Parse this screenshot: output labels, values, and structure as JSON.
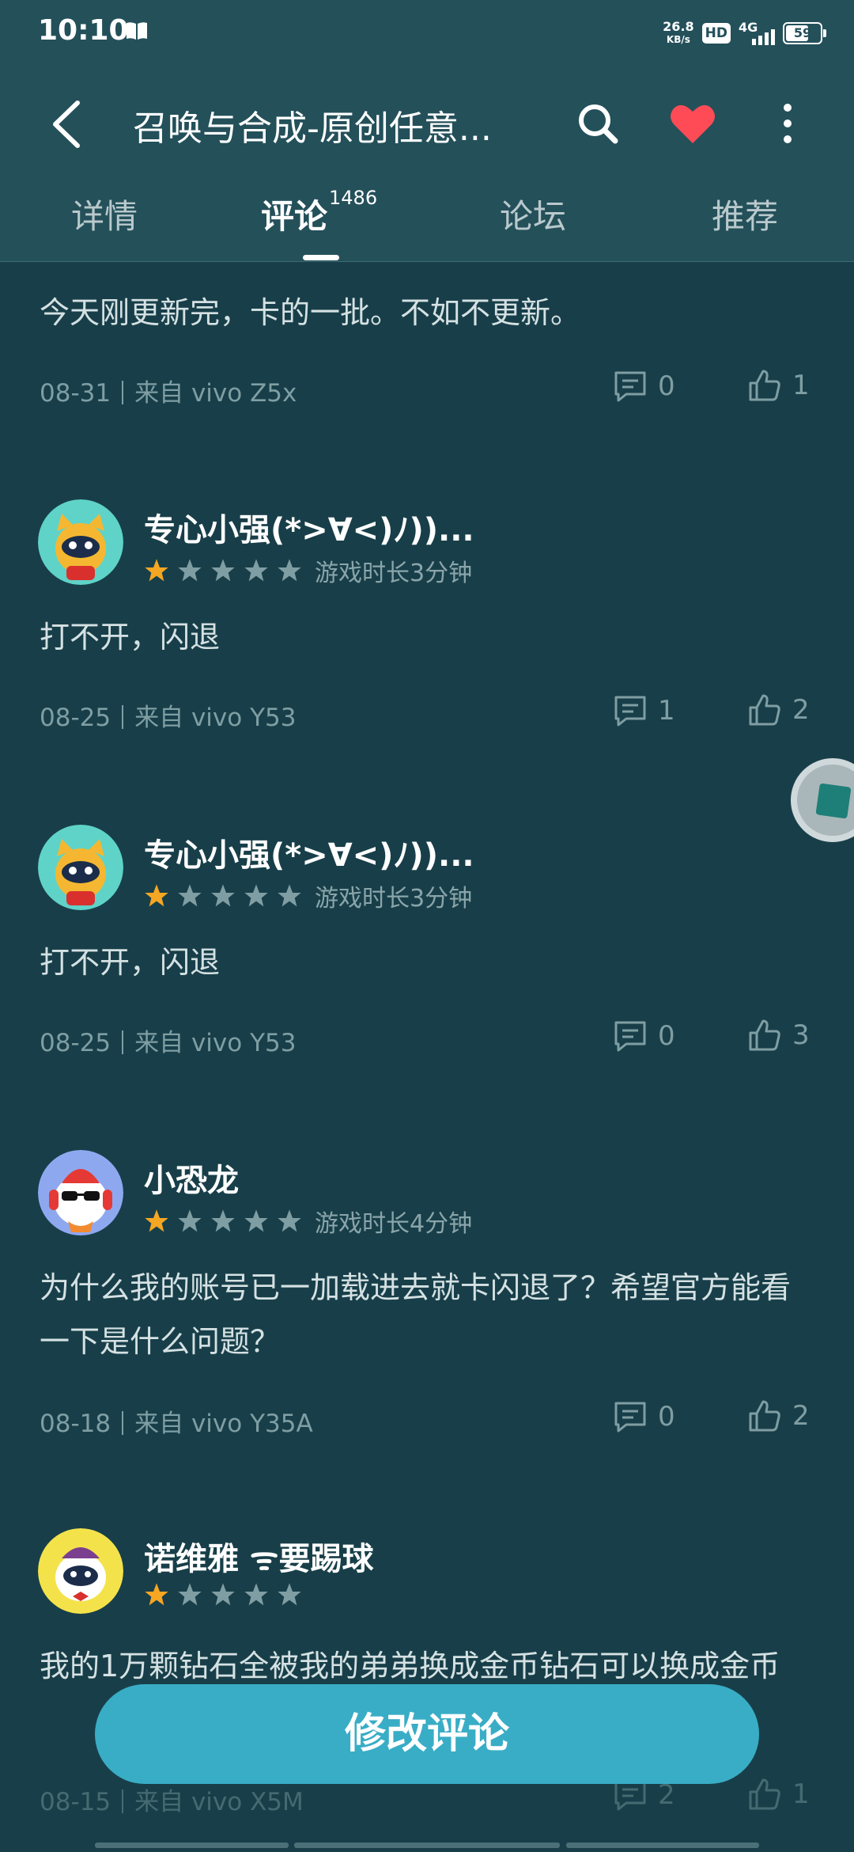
{
  "status_bar": {
    "time": "10:10",
    "net_speed_value": "26.8",
    "net_speed_unit": "KB/s",
    "hd_badge": "HD",
    "network": "4G",
    "battery": "59"
  },
  "header": {
    "title": "召唤与合成-原创任意...",
    "tabs": [
      {
        "label": "详情"
      },
      {
        "label": "评论",
        "count": "1486"
      },
      {
        "label": "论坛"
      },
      {
        "label": "推荐"
      }
    ],
    "active_tab": "评论"
  },
  "colors": {
    "background": "#183f49",
    "header": "#24505a",
    "accent": "#39adc6",
    "favorite": "#ff4b55",
    "star_filled": "#f5a623",
    "star_empty": "#7f9ea3"
  },
  "reviews": [
    {
      "text": "今天刚更新完，卡的一批。不如不更新。",
      "date": "08-31",
      "source": "来自 vivo Z5x",
      "comments": "0",
      "likes": "1"
    },
    {
      "user": "专心小强(*>∀<)ﾉ))...",
      "rating": 1,
      "playtime": "游戏时长3分钟",
      "text": "打不开，闪退",
      "date": "08-25",
      "source": "来自 vivo Y53",
      "comments": "1",
      "likes": "2"
    },
    {
      "user": "专心小强(*>∀<)ﾉ))...",
      "rating": 1,
      "playtime": "游戏时长3分钟",
      "text": "打不开，闪退",
      "date": "08-25",
      "source": "来自 vivo Y53",
      "comments": "0",
      "likes": "3"
    },
    {
      "user": "小恐龙",
      "rating": 1,
      "playtime": "游戏时长4分钟",
      "text": "为什么我的账号已一加载进去就卡闪退了？希望官方能看一下是什么问题？",
      "date": "08-18",
      "source": "来自 vivo Y35A",
      "comments": "0",
      "likes": "2"
    },
    {
      "user": "诺维雅 ᯤ要踢球",
      "rating": 1,
      "playtime": "",
      "text": "我的1万颗钻石全被我的弟弟换成金币钻石可以换成金币",
      "date": "08-15",
      "source": "来自 vivo X5M",
      "comments": "2",
      "likes": "1"
    }
  ],
  "edit_button": "修改评论"
}
